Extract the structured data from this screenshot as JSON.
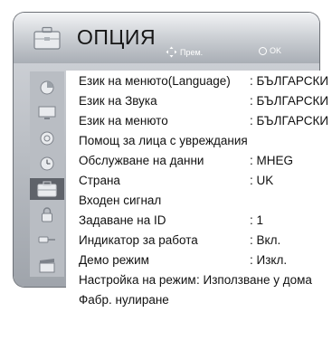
{
  "header": {
    "title": "ОПЦИЯ",
    "hint_move": "Прем.",
    "hint_ok": "OK"
  },
  "sidebar": {
    "items": [
      {
        "icon": "picture-icon",
        "active": false
      },
      {
        "icon": "screen-icon",
        "active": false
      },
      {
        "icon": "audio-icon",
        "active": false
      },
      {
        "icon": "time-icon",
        "active": false
      },
      {
        "icon": "option-icon",
        "active": true
      },
      {
        "icon": "lock-icon",
        "active": false
      },
      {
        "icon": "input-icon",
        "active": false
      },
      {
        "icon": "media-icon",
        "active": false
      }
    ]
  },
  "menu": {
    "items": [
      {
        "label": "Език на менюто(Language)",
        "value": "БЪЛГАРСКИ"
      },
      {
        "label": "Език на Звука",
        "value": "БЪЛГАРСКИ"
      },
      {
        "label": "Език на менюто",
        "value": "БЪЛГАРСКИ"
      },
      {
        "label": "Помощ за лица с увреждания",
        "value": ""
      },
      {
        "label": "Обслужване на данни",
        "value": "MHEG"
      },
      {
        "label": "Страна",
        "value": "UK"
      },
      {
        "label": "Входен сигнал",
        "value": ""
      },
      {
        "label": "Задаване на ID",
        "value": "1"
      },
      {
        "label": "Индикатор за работа",
        "value": "Вкл."
      },
      {
        "label": "Демо режим",
        "value": "Изкл."
      },
      {
        "label": "Настройка на режим",
        "value": "Използване у дома"
      },
      {
        "label": "Фабр. нулиране",
        "value": ""
      }
    ]
  }
}
